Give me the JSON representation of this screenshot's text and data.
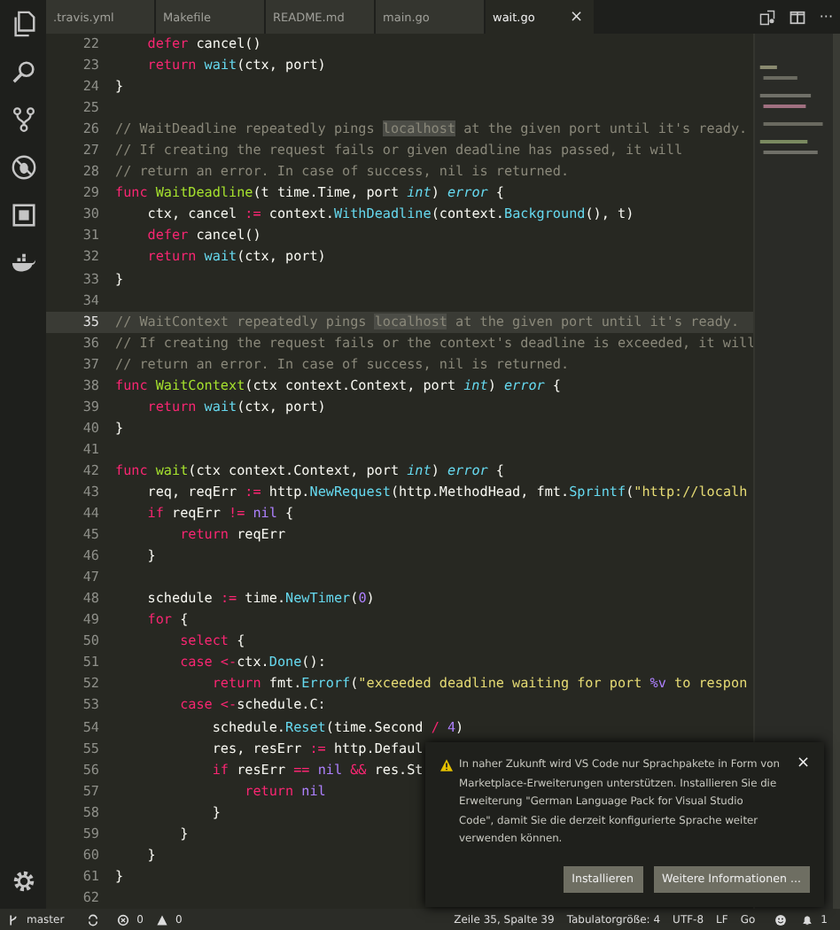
{
  "tabs": [
    {
      "label": ".travis.yml",
      "selected": false
    },
    {
      "label": "Makefile",
      "selected": false
    },
    {
      "label": "README.md",
      "selected": false
    },
    {
      "label": "main.go",
      "selected": false
    },
    {
      "label": "wait.go",
      "selected": true,
      "close": "×"
    }
  ],
  "tab_actions": {
    "more": "···"
  },
  "editor": {
    "lines": [
      {
        "number": "22",
        "current": false,
        "tokens": [
          {
            "text": "    defer",
            "kind": "k"
          },
          {
            "text": " cancel()",
            "kind": "p"
          }
        ]
      },
      {
        "number": "23",
        "current": false,
        "tokens": [
          {
            "text": "    return ",
            "kind": "k"
          },
          {
            "text": "wait",
            "kind": "c"
          },
          {
            "text": "(ctx, port)",
            "kind": "p"
          }
        ]
      },
      {
        "number": "24",
        "current": false,
        "tokens": [
          {
            "text": "}",
            "kind": "p"
          }
        ]
      },
      {
        "number": "25",
        "current": false
      },
      {
        "number": "26",
        "current": false,
        "tokens": [
          {
            "text": "// WaitDeadline repeatedly pings ",
            "kind": "m"
          },
          {
            "text": "localhost",
            "kind": "h"
          },
          {
            "text": " at the given port until it's ready.",
            "kind": "m"
          }
        ]
      },
      {
        "number": "27",
        "current": false,
        "tokens": [
          {
            "text": "// If creating the request fails or given deadline has passed, it will",
            "kind": "m"
          }
        ]
      },
      {
        "number": "28",
        "current": false,
        "tokens": [
          {
            "text": "// return an error. In case of success, nil is returned.",
            "kind": "m"
          }
        ]
      },
      {
        "number": "29",
        "current": false,
        "tokens": [
          {
            "text": "func ",
            "kind": "k"
          },
          {
            "text": "WaitDeadline",
            "kind": "f"
          },
          {
            "text": "(t time.Time, port ",
            "kind": "p"
          },
          {
            "text": "int",
            "kind": "t"
          },
          {
            "text": ") ",
            "kind": "p"
          },
          {
            "text": "error",
            "kind": "t"
          },
          {
            "text": " {",
            "kind": "p"
          }
        ]
      },
      {
        "number": "30",
        "current": false,
        "tokens": [
          {
            "text": "    ctx, cancel ",
            "kind": "p"
          },
          {
            "text": ":=",
            "kind": "o"
          },
          {
            "text": " context.",
            "kind": "p"
          },
          {
            "text": "WithDeadline",
            "kind": "c"
          },
          {
            "text": "(context.",
            "kind": "p"
          },
          {
            "text": "Background",
            "kind": "c"
          },
          {
            "text": "(), t)",
            "kind": "p"
          }
        ]
      },
      {
        "number": "31",
        "current": false,
        "tokens": [
          {
            "text": "    defer",
            "kind": "k"
          },
          {
            "text": " cancel()",
            "kind": "p"
          }
        ]
      },
      {
        "number": "32",
        "current": false,
        "tokens": [
          {
            "text": "    return ",
            "kind": "k"
          },
          {
            "text": "wait",
            "kind": "c"
          },
          {
            "text": "(ctx, port)",
            "kind": "p"
          }
        ]
      },
      {
        "number": "33",
        "current": false,
        "tokens": [
          {
            "text": "}",
            "kind": "p"
          }
        ]
      },
      {
        "number": "34",
        "current": false
      },
      {
        "number": "35",
        "current": true,
        "tokens": [
          {
            "text": "// WaitContext repeatedly pings ",
            "kind": "m"
          },
          {
            "text": "localhost",
            "kind": "h"
          },
          {
            "text": " at the given port until it's ready.",
            "kind": "m"
          }
        ]
      },
      {
        "number": "36",
        "current": false,
        "tokens": [
          {
            "text": "// If creating the request fails or the context's deadline is exceeded, it will",
            "kind": "m"
          }
        ]
      },
      {
        "number": "37",
        "current": false,
        "tokens": [
          {
            "text": "// return an error. In case of success, nil is returned.",
            "kind": "m"
          }
        ]
      },
      {
        "number": "38",
        "current": false,
        "tokens": [
          {
            "text": "func ",
            "kind": "k"
          },
          {
            "text": "WaitContext",
            "kind": "f"
          },
          {
            "text": "(ctx context.Context, port ",
            "kind": "p"
          },
          {
            "text": "int",
            "kind": "t"
          },
          {
            "text": ") ",
            "kind": "p"
          },
          {
            "text": "error",
            "kind": "t"
          },
          {
            "text": " {",
            "kind": "p"
          }
        ]
      },
      {
        "number": "39",
        "current": false,
        "tokens": [
          {
            "text": "    return ",
            "kind": "k"
          },
          {
            "text": "wait",
            "kind": "c"
          },
          {
            "text": "(ctx, port)",
            "kind": "p"
          }
        ]
      },
      {
        "number": "40",
        "current": false,
        "tokens": [
          {
            "text": "}",
            "kind": "p"
          }
        ]
      },
      {
        "number": "41",
        "current": false
      },
      {
        "number": "42",
        "current": false,
        "tokens": [
          {
            "text": "func ",
            "kind": "k"
          },
          {
            "text": "wait",
            "kind": "f"
          },
          {
            "text": "(ctx context.Context, port ",
            "kind": "p"
          },
          {
            "text": "int",
            "kind": "t"
          },
          {
            "text": ") ",
            "kind": "p"
          },
          {
            "text": "error",
            "kind": "t"
          },
          {
            "text": " {",
            "kind": "p"
          }
        ]
      },
      {
        "number": "43",
        "current": false,
        "tokens": [
          {
            "text": "    req, reqErr ",
            "kind": "p"
          },
          {
            "text": ":=",
            "kind": "o"
          },
          {
            "text": " http.",
            "kind": "p"
          },
          {
            "text": "NewRequest",
            "kind": "c"
          },
          {
            "text": "(http.MethodHead, fmt.",
            "kind": "p"
          },
          {
            "text": "Sprintf",
            "kind": "c"
          },
          {
            "text": "(",
            "kind": "p"
          },
          {
            "text": "\"http://localh",
            "kind": "s"
          }
        ]
      },
      {
        "number": "44",
        "current": false,
        "tokens": [
          {
            "text": "    if",
            "kind": "k"
          },
          {
            "text": " reqErr ",
            "kind": "p"
          },
          {
            "text": "!= ",
            "kind": "o"
          },
          {
            "text": "nil",
            "kind": "n"
          },
          {
            "text": " {",
            "kind": "p"
          }
        ]
      },
      {
        "number": "45",
        "current": false,
        "tokens": [
          {
            "text": "        return",
            "kind": "k"
          },
          {
            "text": " reqErr",
            "kind": "p"
          }
        ]
      },
      {
        "number": "46",
        "current": false,
        "tokens": [
          {
            "text": "    }",
            "kind": "p"
          }
        ]
      },
      {
        "number": "47",
        "current": false
      },
      {
        "number": "48",
        "current": false,
        "tokens": [
          {
            "text": "    schedule ",
            "kind": "p"
          },
          {
            "text": ":=",
            "kind": "o"
          },
          {
            "text": " time.",
            "kind": "p"
          },
          {
            "text": "NewTimer",
            "kind": "c"
          },
          {
            "text": "(",
            "kind": "p"
          },
          {
            "text": "0",
            "kind": "n"
          },
          {
            "text": ")",
            "kind": "p"
          }
        ]
      },
      {
        "number": "49",
        "current": false,
        "tokens": [
          {
            "text": "    for",
            "kind": "k"
          },
          {
            "text": " {",
            "kind": "p"
          }
        ]
      },
      {
        "number": "50",
        "current": false,
        "tokens": [
          {
            "text": "        select",
            "kind": "k"
          },
          {
            "text": " {",
            "kind": "p"
          }
        ]
      },
      {
        "number": "51",
        "current": false,
        "tokens": [
          {
            "text": "        case <-",
            "kind": "k"
          },
          {
            "text": "ctx.",
            "kind": "p"
          },
          {
            "text": "Done",
            "kind": "c"
          },
          {
            "text": "():",
            "kind": "p"
          }
        ]
      },
      {
        "number": "52",
        "current": false,
        "tokens": [
          {
            "text": "            return",
            "kind": "k"
          },
          {
            "text": " fmt.",
            "kind": "p"
          },
          {
            "text": "Errorf",
            "kind": "c"
          },
          {
            "text": "(",
            "kind": "p"
          },
          {
            "text": "\"exceeded deadline waiting for port ",
            "kind": "s"
          },
          {
            "text": "%v",
            "kind": "n"
          },
          {
            "text": " to respon",
            "kind": "s"
          }
        ]
      },
      {
        "number": "53",
        "current": false,
        "tokens": [
          {
            "text": "        case <-",
            "kind": "k"
          },
          {
            "text": "schedule.C:",
            "kind": "p"
          }
        ]
      },
      {
        "number": "54",
        "current": false,
        "tokens": [
          {
            "text": "            schedule.",
            "kind": "p"
          },
          {
            "text": "Reset",
            "kind": "c"
          },
          {
            "text": "(time.Second ",
            "kind": "p"
          },
          {
            "text": "/ ",
            "kind": "o"
          },
          {
            "text": "4",
            "kind": "n"
          },
          {
            "text": ")",
            "kind": "p"
          }
        ]
      },
      {
        "number": "55",
        "current": false,
        "tokens": [
          {
            "text": "            res, resErr ",
            "kind": "p"
          },
          {
            "text": ":=",
            "kind": "o"
          },
          {
            "text": " http.Defaul",
            "kind": "p"
          }
        ]
      },
      {
        "number": "56",
        "current": false,
        "tokens": [
          {
            "text": "            if",
            "kind": "k"
          },
          {
            "text": " resErr ",
            "kind": "p"
          },
          {
            "text": "== ",
            "kind": "o"
          },
          {
            "text": "nil",
            "kind": "n"
          },
          {
            "text": " &&",
            "kind": "o"
          },
          {
            "text": " res.St",
            "kind": "p"
          }
        ]
      },
      {
        "number": "57",
        "current": false,
        "tokens": [
          {
            "text": "                return ",
            "kind": "k"
          },
          {
            "text": "nil",
            "kind": "n"
          }
        ]
      },
      {
        "number": "58",
        "current": false,
        "tokens": [
          {
            "text": "            }",
            "kind": "p"
          }
        ]
      },
      {
        "number": "59",
        "current": false,
        "tokens": [
          {
            "text": "        }",
            "kind": "p"
          }
        ]
      },
      {
        "number": "60",
        "current": false,
        "tokens": [
          {
            "text": "    }",
            "kind": "p"
          }
        ]
      },
      {
        "number": "61",
        "current": false,
        "tokens": [
          {
            "text": "}",
            "kind": "p"
          }
        ]
      },
      {
        "number": "62",
        "current": false
      }
    ]
  },
  "notification": {
    "message": "In naher Zukunft wird VS Code nur Sprachpakete in Form von Marketplace-Erweiterungen unterstützen. Installieren Sie die Erweiterung \"German Language Pack for Visual Studio Code\", damit Sie die derzeit konfigurierte Sprache weiter verwenden können.",
    "close": "×",
    "buttons": [
      "Installieren",
      "Weitere Informationen ..."
    ]
  },
  "status_bar": {
    "branch": "master",
    "errors": "0",
    "warnings": "0",
    "position": "Zeile 35, Spalte 39",
    "indentation": "Tabulatorgröße: 4",
    "encoding": "UTF-8",
    "eol": "LF",
    "language": "Go",
    "notifications": "1"
  }
}
